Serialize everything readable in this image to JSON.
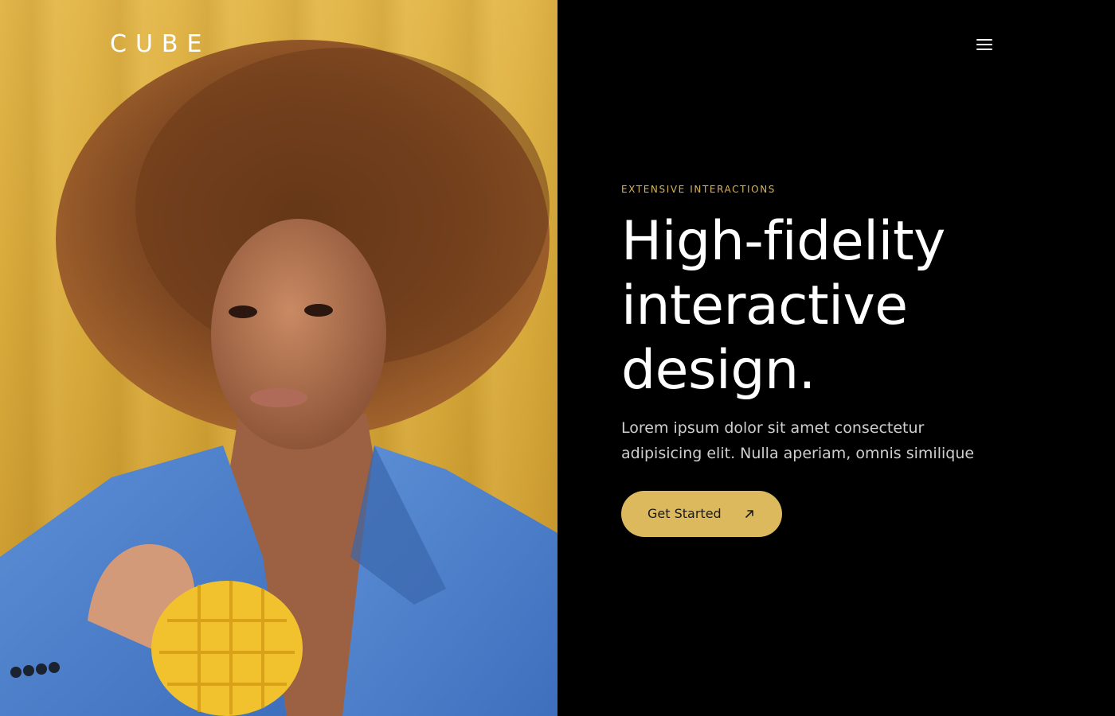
{
  "brand": {
    "logo_text": "CUBE"
  },
  "header": {
    "menu_icon": "hamburger-menu-icon"
  },
  "hero": {
    "eyebrow": "EXTENSIVE INTERACTIONS",
    "headline_lines": [
      "High-fidelity",
      "interactive",
      "design."
    ],
    "subtext_lines": [
      "Lorem ipsum dolor sit amet consectetur",
      "adipisicing elit. Nulla aperiam, omnis similique"
    ],
    "cta_label": "Get Started",
    "cta_icon": "arrow-up-right-icon"
  },
  "colors": {
    "accent": "#dcb95c",
    "background": "#000000",
    "text_primary": "#ffffff",
    "text_secondary": "#cfcfcf"
  }
}
